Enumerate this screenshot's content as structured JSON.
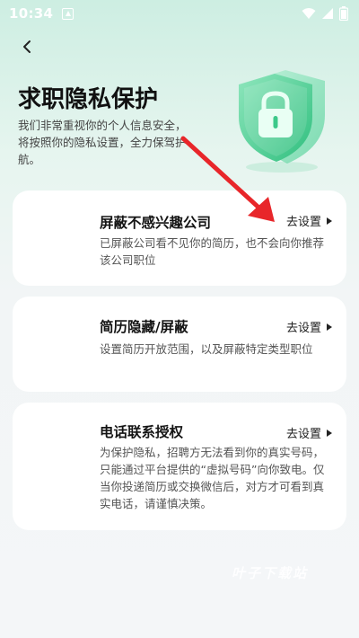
{
  "status_bar": {
    "time": "10:34"
  },
  "header": {
    "title": "求职隐私保护",
    "subtitle": "我们非常重视你的个人信息安全，将按照你的隐私设置，全力保驾护航。"
  },
  "cards": [
    {
      "title": "屏蔽不感兴趣公司",
      "action": "去设置",
      "desc": "已屏蔽公司看不见你的简历，也不会向你推荐该公司职位"
    },
    {
      "title": "简历隐藏/屏蔽",
      "action": "去设置",
      "desc": "设置简历开放范围，以及屏蔽特定类型职位"
    },
    {
      "title": "电话联系授权",
      "action": "去设置",
      "desc": "为保护隐私，招聘方无法看到你的真实号码，只能通过平台提供的“虚拟号码”向你致电。仅当你投递简历或交换微信后，对方才可看到真实电话，请谨慎决策。"
    }
  ],
  "watermark": "叶子下载站",
  "colors": {
    "accent_green": "#3cc98a",
    "arrow_red": "#e8262a"
  }
}
